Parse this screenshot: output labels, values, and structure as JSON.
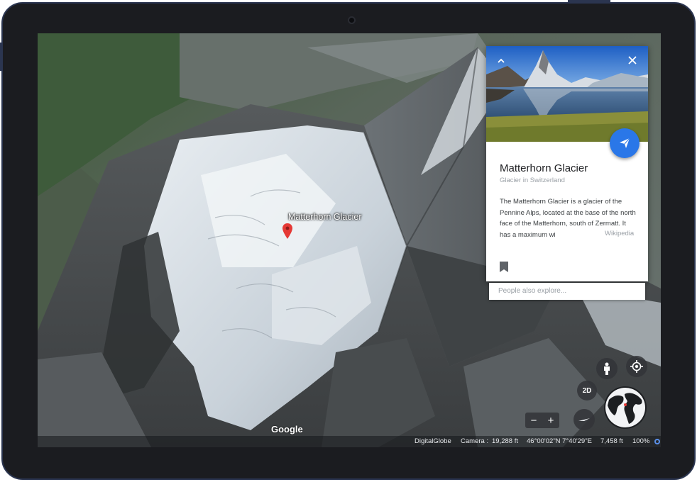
{
  "map": {
    "place_label": "Matterhorn Glacier",
    "logo": "Google"
  },
  "card": {
    "title": "Matterhorn Glacier",
    "subtitle": "Glacier in Switzerland",
    "description": "The Matterhorn Glacier is a glacier of the Pennine Alps, located at the base of the north face of the Matterhorn, south of Zermatt. It has a maximum wi",
    "source_link": "Wikipedia",
    "icons": {
      "collapse": "chevron-up-icon",
      "close": "close-icon",
      "share": "send-icon",
      "bookmark": "bookmark-icon"
    },
    "accent_color": "#2a77e8"
  },
  "explore": {
    "placeholder": "People also explore..."
  },
  "controls": {
    "view_toggle_label": "2D",
    "zoom_out": "−",
    "zoom_in": "+",
    "icons": [
      "pegman-icon",
      "my-location-icon",
      "compass-icon",
      "globe-icon"
    ]
  },
  "status": {
    "imagery": "DigitalGlobe",
    "camera_label": "Camera :",
    "camera_altitude": "19,288 ft",
    "coordinates": "46°00'02\"N 7°40'29\"E",
    "elevation": "7,458 ft",
    "streaming": "100%"
  }
}
